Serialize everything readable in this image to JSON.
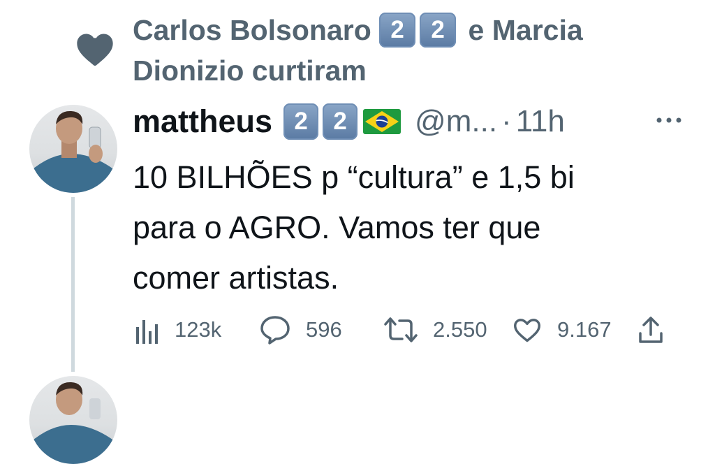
{
  "social_context": {
    "icon": "heart-icon",
    "name1": "Carlos Bolsonaro",
    "badges1": [
      "2",
      "2"
    ],
    "connector": "e Marcia",
    "line2": "Dionizio curtiram"
  },
  "tweet": {
    "display_name": "mattheus",
    "badges": [
      "2",
      "2"
    ],
    "flag": "brazil-flag",
    "handle": "@m...",
    "separator": "·",
    "time": "11h",
    "text_lines": [
      "10 BILHÕES p “cultura” e 1,5 bi",
      "para o AGRO. Vamos ter que",
      "comer artistas."
    ],
    "actions": {
      "views": "123k",
      "replies": "596",
      "reposts": "2.550",
      "likes": "9.167"
    }
  },
  "colors": {
    "text_primary": "#0f1419",
    "text_secondary": "#536471",
    "thread_line": "#cfd9de",
    "keycap": "#6f8eb5"
  }
}
